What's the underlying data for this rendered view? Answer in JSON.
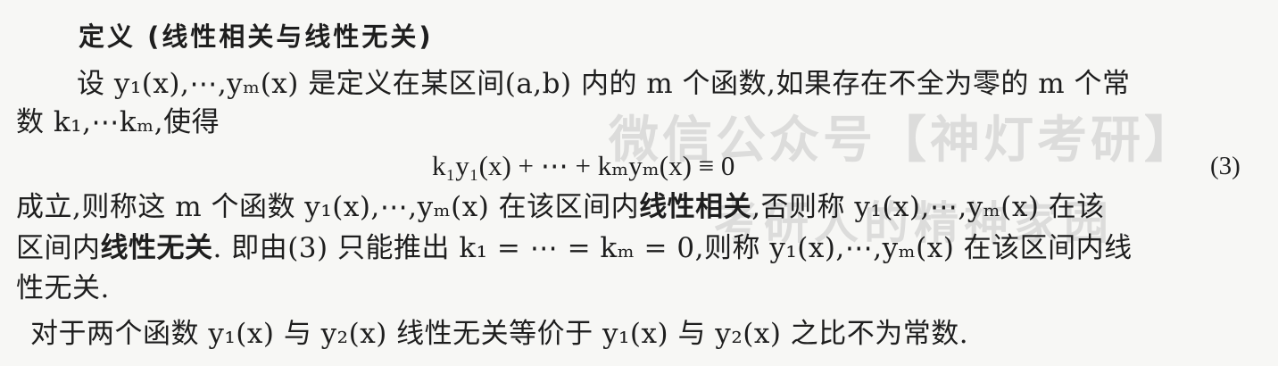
{
  "heading": "定义 (线性相关与线性无关)",
  "para1": {
    "l1": "设 y₁(x),⋯,yₘ(x) 是定义在某区间(a,b) 内的 m 个函数,如果存在不全为零的 m 个常",
    "l2": "数 k₁,⋯kₘ,使得"
  },
  "equation": {
    "text": "k₁y₁(x) + ⋯ + kₘyₘ(x) ≡ 0",
    "number": "(3)"
  },
  "para2": {
    "l1_a": "成立,则称这 m 个函数 y₁(x),⋯,yₘ(x) 在该区间内",
    "l1_bold": "线性相关",
    "l1_b": ",否则称 y₁(x),⋯,yₘ(x) 在该",
    "l2_a": "区间内",
    "l2_bold": "线性无关",
    "l2_b": ". 即由(3) 只能推出 k₁ = ⋯ = kₘ = 0,则称 y₁(x),⋯,yₘ(x) 在该区间内线",
    "l3": "性无关."
  },
  "para3": "对于两个函数 y₁(x) 与 y₂(x) 线性无关等价于 y₁(x) 与 y₂(x) 之比不为常数.",
  "watermark": {
    "line1": "微信公众号【神灯考研】",
    "line2": "考研人的精神家园"
  }
}
